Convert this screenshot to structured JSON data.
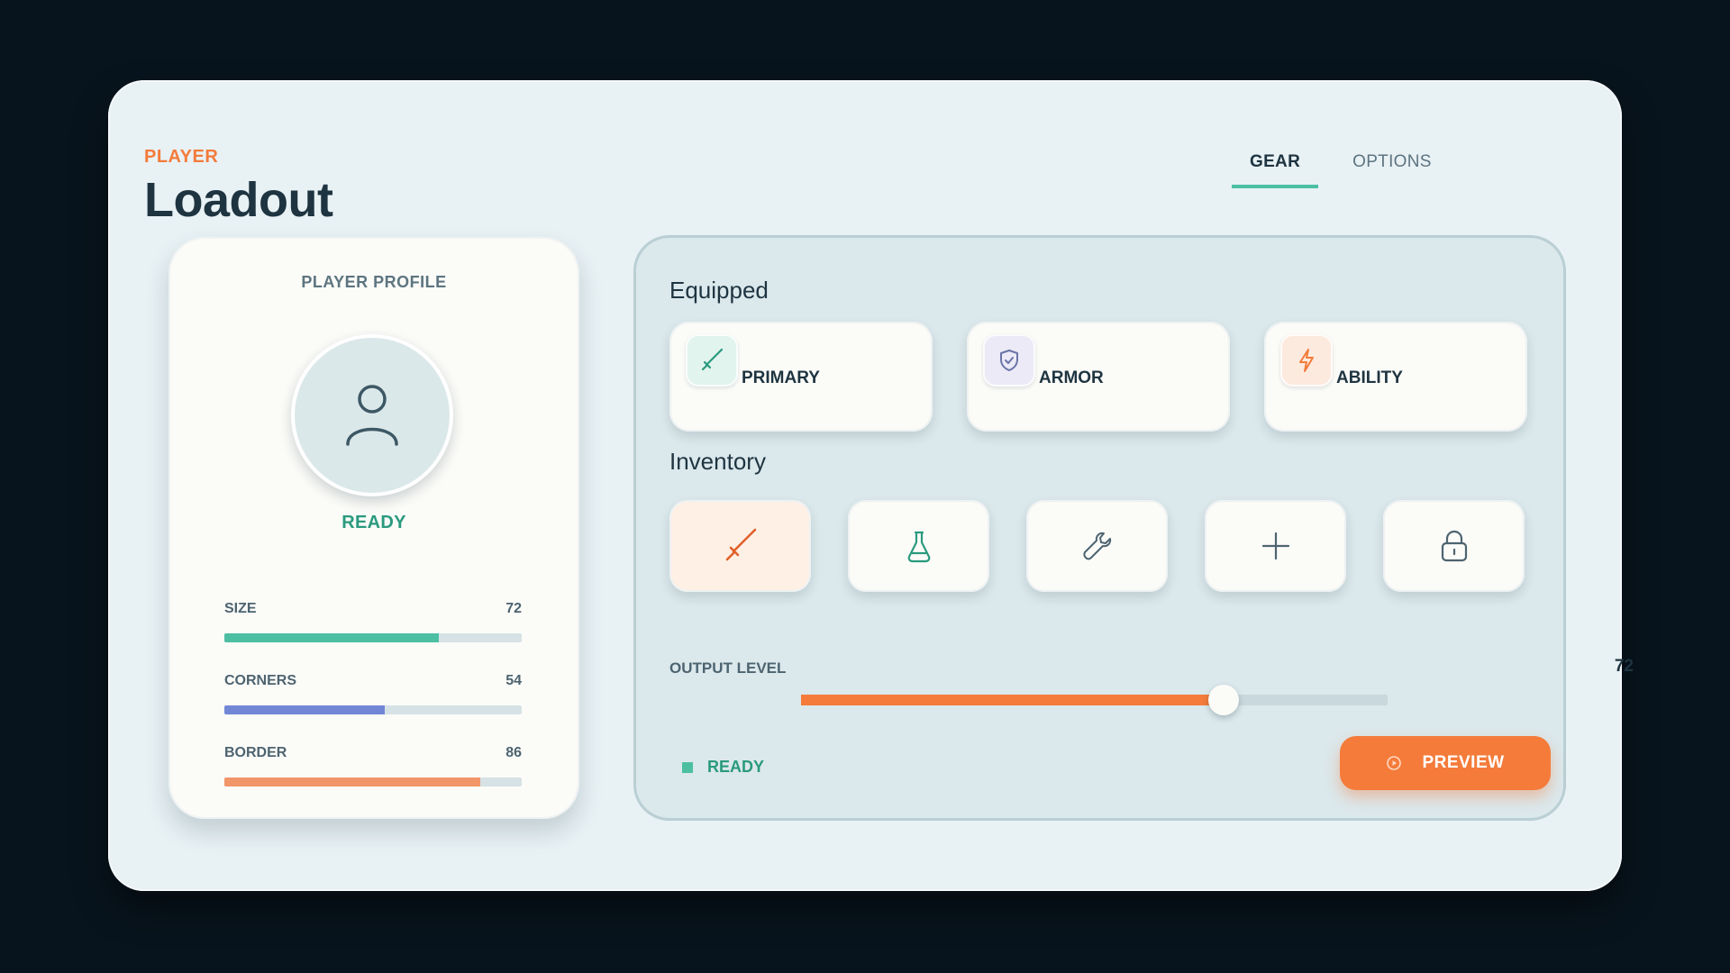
{
  "header": {
    "subtitle": "PLAYER",
    "title": "Loadout"
  },
  "tabs": [
    {
      "label": "GEAR",
      "active": true
    },
    {
      "label": "OPTIONS",
      "active": false
    }
  ],
  "profile": {
    "title": "PLAYER PROFILE",
    "avatar_icon": "user-icon",
    "status": "READY",
    "stats": [
      {
        "label": "SIZE",
        "value": 72,
        "max": 100,
        "color": "#4cbfa3"
      },
      {
        "label": "CORNERS",
        "value": 54,
        "max": 100,
        "color": "#7187d6"
      },
      {
        "label": "BORDER",
        "value": 86,
        "max": 100,
        "color": "#f2966a"
      }
    ]
  },
  "equipped": {
    "title": "Equipped",
    "items": [
      {
        "label": "PRIMARY",
        "icon": "sword-icon",
        "bg": "#e2f4ee",
        "color": "#2a9a7e"
      },
      {
        "label": "ARMOR",
        "icon": "shield-icon",
        "bg": "#ebeaf6",
        "color": "#6a74a8"
      },
      {
        "label": "ABILITY",
        "icon": "lightning-icon",
        "bg": "#fdeadf",
        "color": "#f47b3a"
      }
    ]
  },
  "inventory": {
    "title": "Inventory",
    "slots": [
      {
        "icon": "sword-icon",
        "selected": true,
        "color": "#e0612a"
      },
      {
        "icon": "flask-icon",
        "selected": false,
        "color": "#2a9a7e"
      },
      {
        "icon": "wrench-icon",
        "selected": false,
        "color": "#4d6470"
      },
      {
        "icon": "plus-icon",
        "selected": false,
        "color": "#4d6470"
      },
      {
        "icon": "lock-icon",
        "selected": false,
        "color": "#4d6470"
      }
    ]
  },
  "output": {
    "label": "OUTPUT LEVEL",
    "value": 72,
    "max": 100
  },
  "footer": {
    "status": "READY",
    "status_color": "#4cbfa3",
    "button_label": "PREVIEW",
    "button_icon": "play-icon"
  },
  "colors": {
    "accent": "#f47b3a",
    "teal": "#4cbfa3",
    "text": "#1e3440"
  }
}
